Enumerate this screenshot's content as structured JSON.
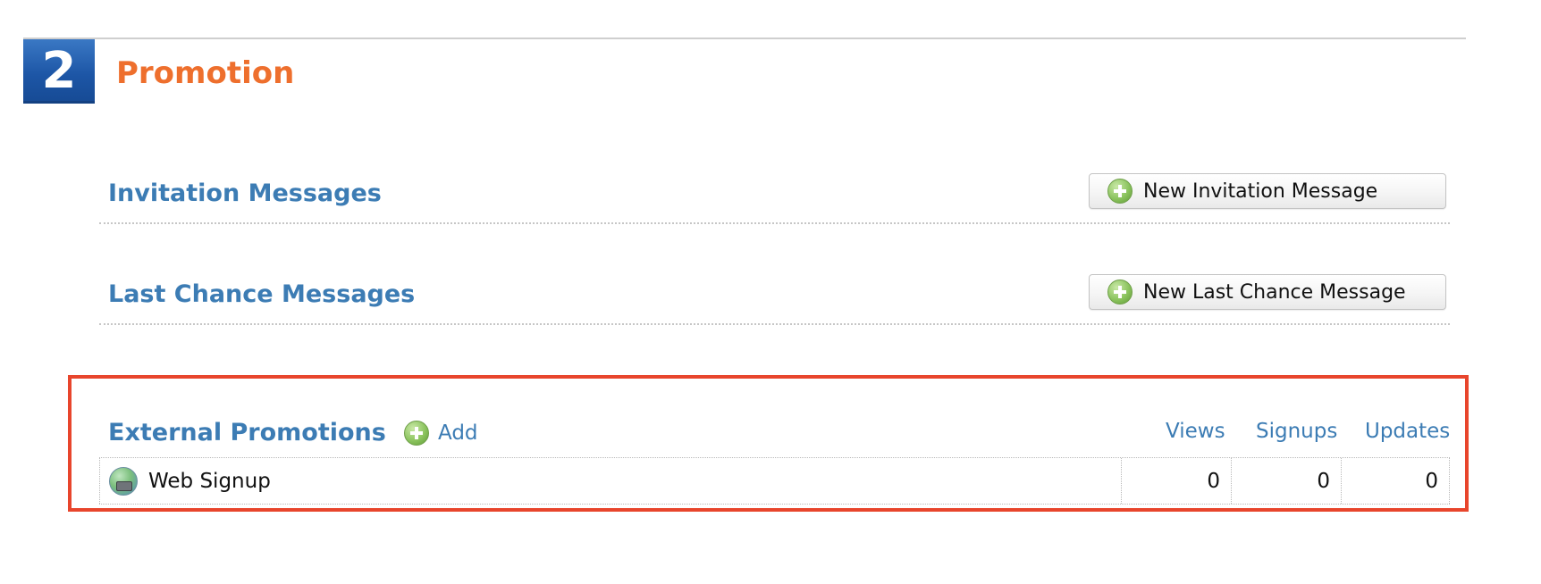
{
  "step": {
    "number": "2",
    "title": "Promotion"
  },
  "invitation": {
    "title": "Invitation Messages",
    "button_label": "New Invitation Message"
  },
  "last_chance": {
    "title": "Last Chance Messages",
    "button_label": "New Last Chance Message"
  },
  "external": {
    "title": "External Promotions",
    "add_label": "Add",
    "columns": [
      "Views",
      "Signups",
      "Updates"
    ],
    "rows": [
      {
        "name": "Web Signup",
        "views": "0",
        "signups": "0",
        "updates": "0",
        "icon": "web-signup-icon"
      }
    ]
  },
  "colors": {
    "accent_orange": "#ee6f2d",
    "section_blue": "#3c7cb4",
    "badge_blue": "#1d56a6",
    "highlight_red": "#e8452c"
  }
}
